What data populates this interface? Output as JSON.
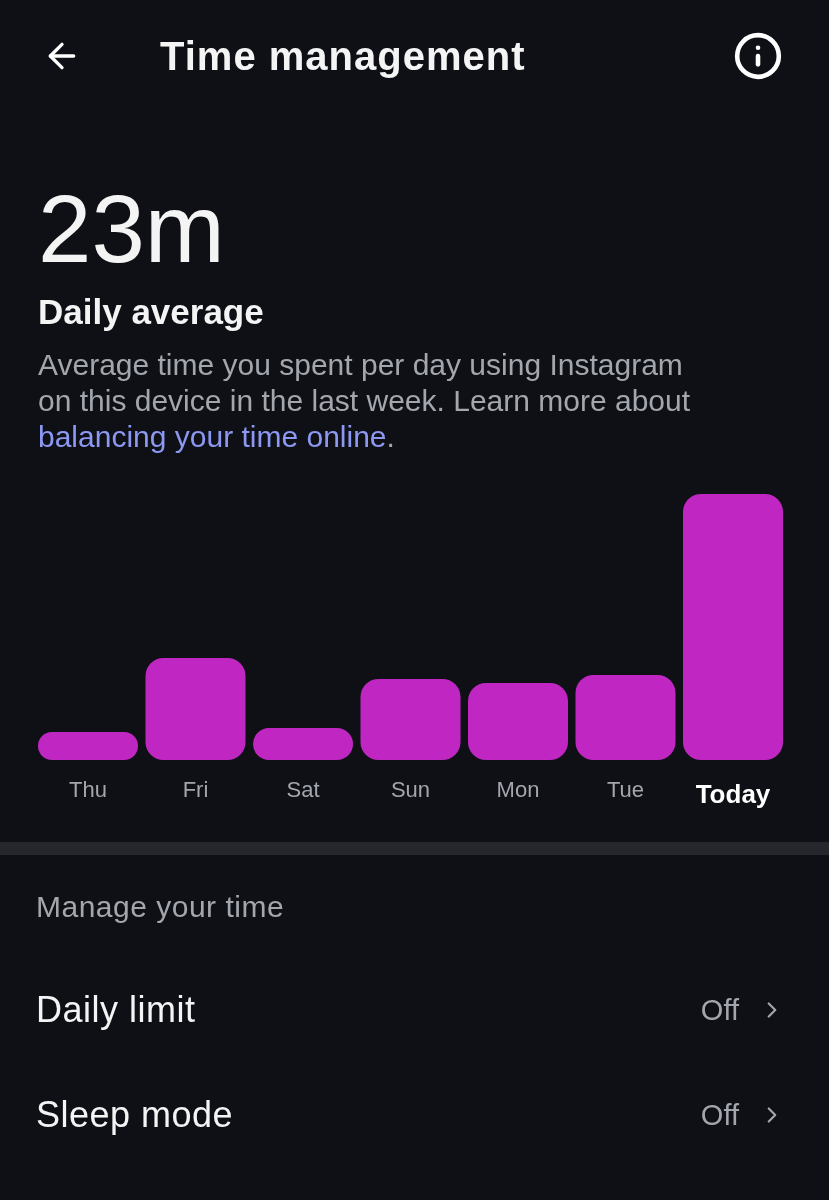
{
  "header": {
    "title": "Time management"
  },
  "summary": {
    "value": "23m",
    "label": "Daily average",
    "description": "Average time you spent per day using Instagram on this device in the last week. Learn more about ",
    "link": "balancing your time online",
    "description_end": "."
  },
  "chart": {
    "days": [
      {
        "label": "Thu",
        "selected": false
      },
      {
        "label": "Fri",
        "selected": false
      },
      {
        "label": "Sat",
        "selected": false
      },
      {
        "label": "Sun",
        "selected": false
      },
      {
        "label": "Mon",
        "selected": false
      },
      {
        "label": "Tue",
        "selected": false
      },
      {
        "label": "Today",
        "selected": true
      }
    ]
  },
  "manage": {
    "heading": "Manage your time",
    "rows": [
      {
        "label": "Daily limit",
        "value": "Off"
      },
      {
        "label": "Sleep mode",
        "value": "Off"
      }
    ]
  }
}
